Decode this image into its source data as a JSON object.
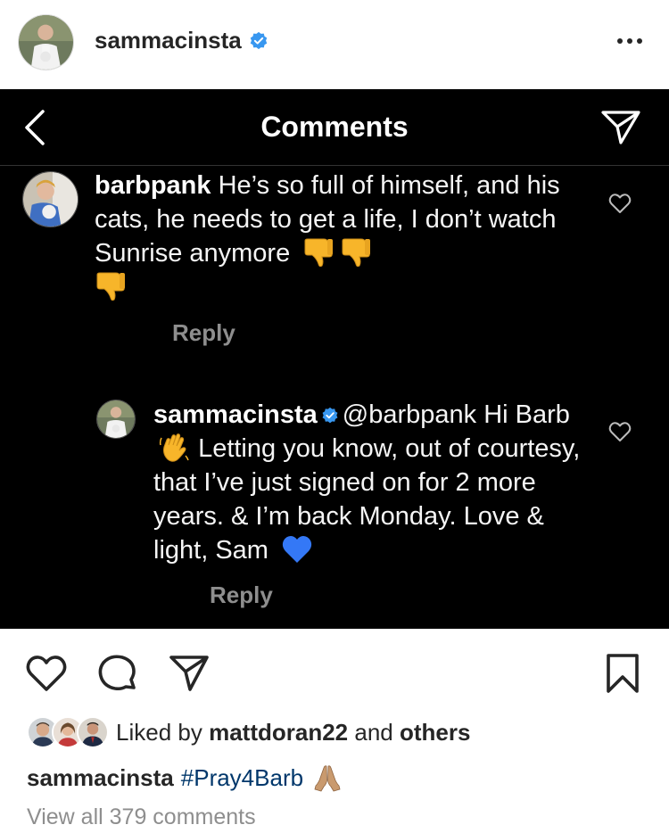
{
  "post": {
    "username": "sammacinsta",
    "verified": true,
    "more_icon": "ellipsis-icon"
  },
  "comments_screen": {
    "title": "Comments",
    "comments": [
      {
        "username": "barbpank",
        "text": "He’s so full of himself, and his cats, he needs to get a life, I don’t watch Sunrise anymore",
        "emojis": [
          "thumbs-down",
          "thumbs-down",
          "thumbs-down"
        ],
        "reply_label": "Reply"
      },
      {
        "username": "sammacinsta",
        "verified": true,
        "text_part1": "@barbpank Hi Barb",
        "emoji_mid": "waving-hand",
        "text_part2": "Letting you know, out of courtesy, that I’ve just signed on for 2 more years. & I’m back Monday. Love & light, Sam",
        "emoji_end": "blue-heart",
        "reply_label": "Reply"
      }
    ]
  },
  "likes": {
    "prefix": "Liked by",
    "user": "mattdoran22",
    "conjunction": "and",
    "others": "others"
  },
  "caption": {
    "username": "sammacinsta",
    "hashtag": "#Pray4Barb",
    "emoji": "folded-hands"
  },
  "view_all_comments": "View all 379 comments",
  "colors": {
    "verified_blue": "#3897f0",
    "link_blue": "#00376b",
    "muted_gray": "#8e8e8e",
    "emoji_yellow": "#f7b52a",
    "heart_blue": "#3478f6"
  }
}
